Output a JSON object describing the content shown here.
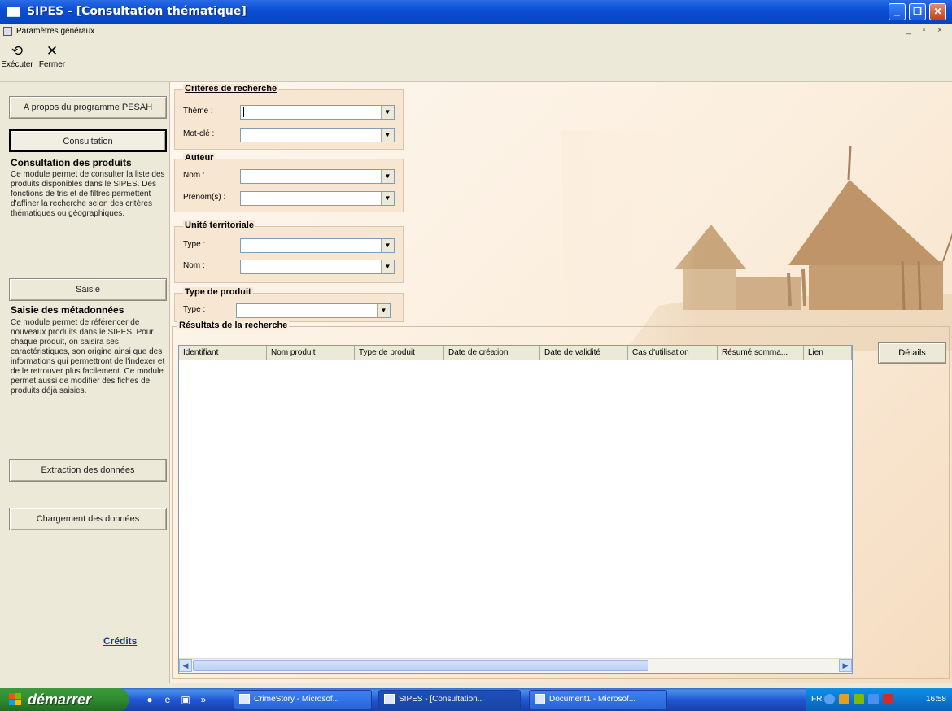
{
  "window": {
    "title": "SIPES - [Consultation thématique]",
    "child_title": "Paramètres généraux"
  },
  "toolbar": {
    "execute_label": "Exécuter",
    "close_label": "Fermer"
  },
  "sidebar": {
    "about_button": "A propos du programme PESAH",
    "consult_button": "Consultation",
    "consult_title": "Consultation des produits",
    "consult_desc": "Ce module permet de consulter la liste des produits disponibles dans le SIPES. Des fonctions de tris et de filtres permettent d'affiner la recherche selon des critères thématiques ou géographiques.",
    "saisie_button": "Saisie",
    "saisie_title": "Saisie des métadonnées",
    "saisie_desc": "Ce module permet de référencer de nouveaux produits dans le SIPES. Pour chaque produit, on saisira ses caractéristiques, son origine ainsi que des informations qui permettront de l'indexer et de le retrouver plus facilement. Ce module permet aussi de modifier des fiches de produits déjà saisies.",
    "extraction_button": "Extraction des données",
    "chargement_button": "Chargement des données",
    "credits": "Crédits"
  },
  "search": {
    "criteres_label": "Critères de recherche",
    "theme_label": "Thème :",
    "motcle_label": "Mot-clé :",
    "auteur_label": "Auteur",
    "nom_label": "Nom :",
    "prenom_label": "Prénom(s) :",
    "unite_label": "Unité territoriale",
    "type_label": "Type :",
    "unite_nom_label": "Nom :",
    "produit_label": "Type de produit",
    "produit_type_label": "Type :"
  },
  "results": {
    "label": "Résultats de la recherche",
    "columns": [
      "Identifiant",
      "Nom produit",
      "Type de produit",
      "Date de création",
      "Date de validité",
      "Cas d'utilisation",
      "Résumé somma...",
      "Lien"
    ],
    "details_button": "Détails"
  },
  "taskbar": {
    "start_label": "démarrer",
    "tasks": [
      "CrimeStory - Microsof...",
      "SIPES - [Consultation...",
      "Document1 - Microsof..."
    ],
    "language": "FR",
    "clock": "16:58"
  }
}
